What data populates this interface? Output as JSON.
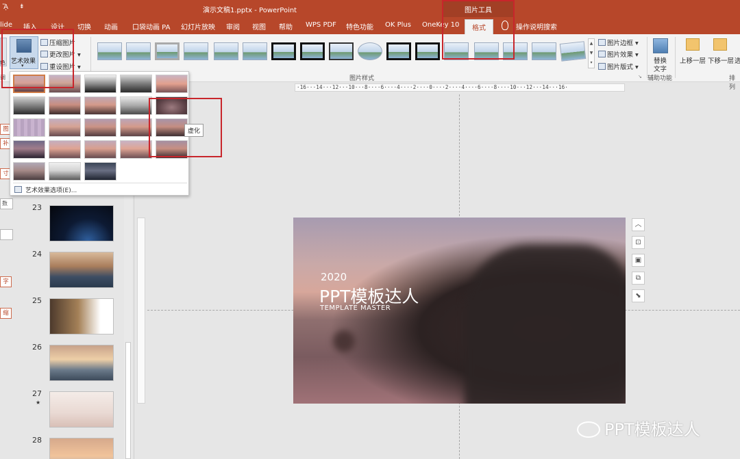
{
  "titlebar": {
    "app_icon": "ᾍ",
    "qat": "⇟",
    "document_title": "演示文稿1.pptx  -  PowerPoint",
    "context_group": "图片工具"
  },
  "tabs": [
    "lide",
    "插入",
    "设计",
    "切换",
    "动画",
    "口袋动画 PA",
    "幻灯片放映",
    "审阅",
    "视图",
    "帮助",
    "WPS PDF",
    "特色功能",
    "OK Plus",
    "OneKey 10",
    "格式"
  ],
  "help_search": "操作说明搜索",
  "ribbon": {
    "artistic_effects": "艺术效果",
    "compress": "压缩图片",
    "change": "更改图片",
    "reset": "重设图片",
    "left_stub_text": "色",
    "left_group_label": "调",
    "picture_styles_label": "图片样式",
    "border": "图片边框",
    "effects": "图片效果",
    "layout": "图片版式",
    "replace_text_1": "替换",
    "replace_text_2": "文字",
    "accessibility_label": "辅助功能",
    "bring_forward": "上移一层",
    "send_backward": "下移一层",
    "more": "选",
    "arrange_label": "排列"
  },
  "dropdown": {
    "option": "艺术效果选项(E)...",
    "tooltip": "虚化"
  },
  "leftstrip": {
    "b1": "图",
    "b2": "补",
    "b3": "寸",
    "field": "数",
    "b4": "字",
    "b5": "缩"
  },
  "slides": [
    {
      "num": "23",
      "star": ""
    },
    {
      "num": "24",
      "star": ""
    },
    {
      "num": "25",
      "star": ""
    },
    {
      "num": "26",
      "star": ""
    },
    {
      "num": "27",
      "star": "★"
    },
    {
      "num": "28",
      "star": ""
    }
  ],
  "ruler": "·16···14···12···10···8····6····4····2····0····2····4····6····8····10···12···14···16·",
  "slide": {
    "year": "2020",
    "title": "PPT模板达人",
    "subtitle": "TEMPLATE  MASTER"
  },
  "watermark": "PPT模板达人",
  "colors": {
    "accent": "#b7472a",
    "annotation": "#c8252b"
  }
}
